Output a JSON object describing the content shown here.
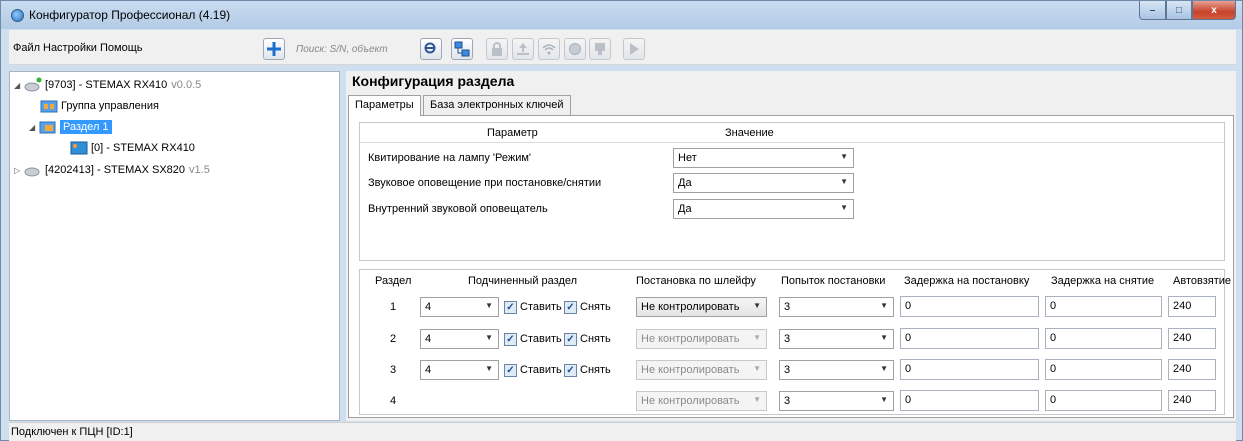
{
  "window": {
    "title": "Конфигуратор Профессионал (4.19)",
    "controls": {
      "minimize": "–",
      "maximize": "□",
      "close": "x"
    }
  },
  "menu": {
    "file": "Файл",
    "settings": "Настройки",
    "help": "Помощь"
  },
  "toolbar": {
    "add_icon": "plus-icon",
    "search_placeholder": "Поиск: S/N, объект",
    "play_icon": "play-icon"
  },
  "tree": {
    "items": [
      {
        "label": "[9703] - STEMAX RX410",
        "version": "v0.0.5",
        "expanded": true
      },
      {
        "label": "Группа управления"
      },
      {
        "label": "Раздел 1",
        "selected": true,
        "expanded": true
      },
      {
        "label": "[0] - STEMAX RX410"
      },
      {
        "label": "[4202413] - STEMAX SX820",
        "version": "v1.5",
        "expanded": false
      }
    ]
  },
  "content": {
    "title": "Конфигурация раздела",
    "tabs": [
      "Параметры",
      "База электронных ключей"
    ],
    "params": {
      "header_param": "Параметр",
      "header_value": "Значение",
      "rows": [
        {
          "label": "Квитирование на лампу 'Режим'",
          "value": "Нет"
        },
        {
          "label": "Звуковое оповещение при постановке/снятии",
          "value": "Да"
        },
        {
          "label": "Внутренний звуковой оповещатель",
          "value": "Да"
        }
      ]
    },
    "sections": {
      "headers": [
        "Раздел",
        "Подчиненный раздел",
        "Постановка по шлейфу",
        "Попыток постановки",
        "Задержка на постановку",
        "Задержка на снятие",
        "Автовзятие"
      ],
      "set_label": "Ставить",
      "unset_label": "Снять",
      "rows": [
        {
          "section": "1",
          "sub": "4",
          "arm_mode": "Не контролировать",
          "attempts": "3",
          "arm_delay": "0",
          "disarm_delay": "0",
          "auto": "240"
        },
        {
          "section": "2",
          "sub": "4",
          "arm_mode": "Не контролировать",
          "attempts": "3",
          "arm_delay": "0",
          "disarm_delay": "0",
          "auto": "240"
        },
        {
          "section": "3",
          "sub": "4",
          "arm_mode": "Не контролировать",
          "attempts": "3",
          "arm_delay": "0",
          "disarm_delay": "0",
          "auto": "240"
        },
        {
          "section": "4",
          "sub": "",
          "arm_mode": "Не контролировать",
          "attempts": "3",
          "arm_delay": "0",
          "disarm_delay": "0",
          "auto": "240"
        }
      ]
    }
  },
  "status": {
    "text": "Подключен к ПЦН [ID:1]"
  }
}
